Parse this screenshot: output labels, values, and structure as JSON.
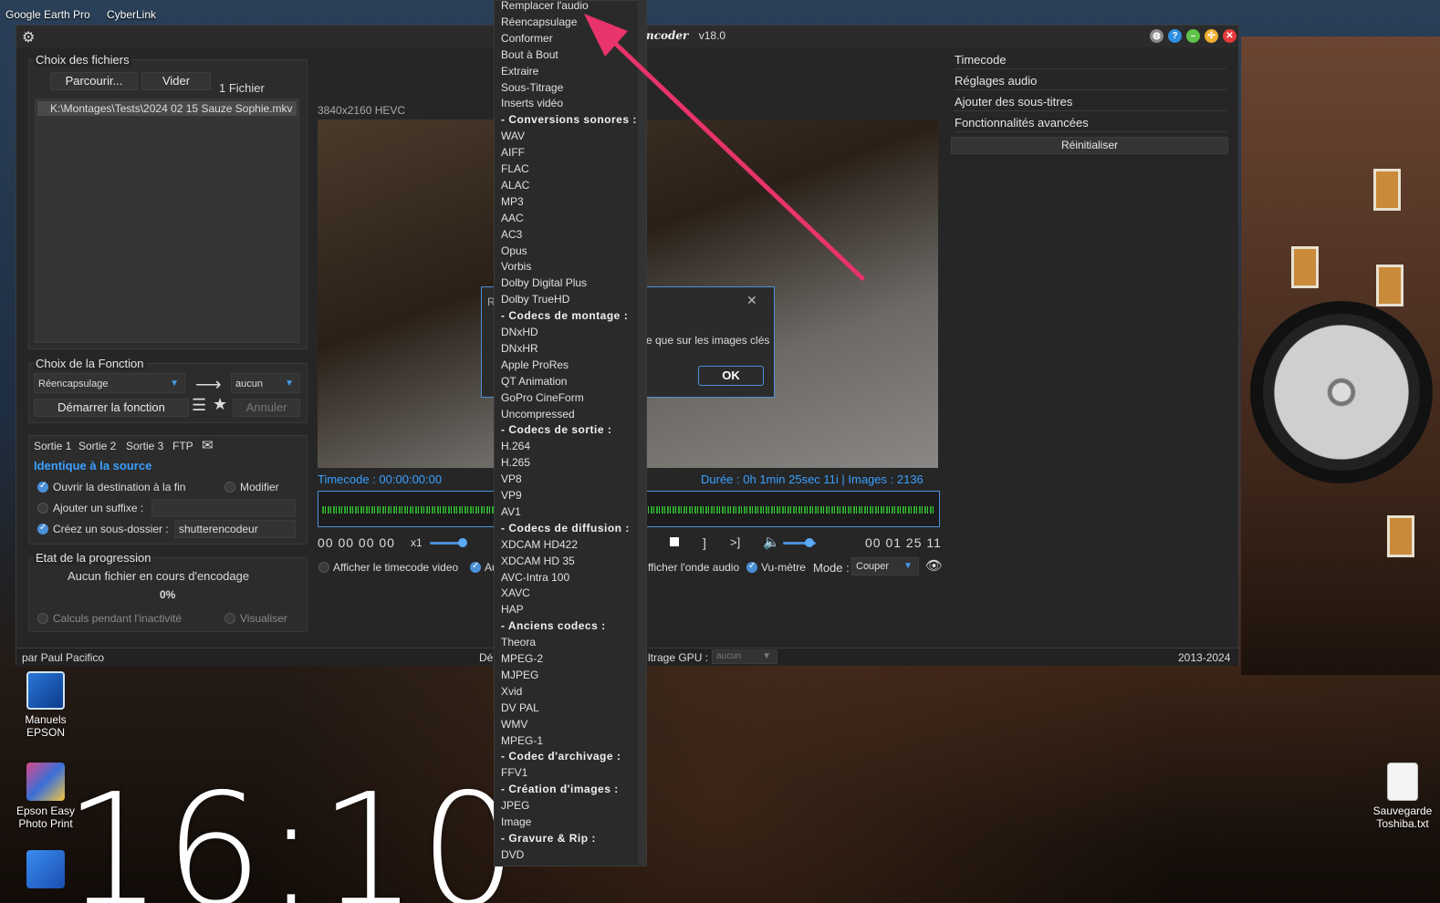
{
  "desktop": {
    "top_icons": [
      "Google Earth Pro",
      "CyberLink"
    ],
    "icons": [
      "Manuels EPSON",
      "Epson Easy Photo Print",
      "Sauvegarde Toshiba.txt"
    ],
    "clock": "16:10"
  },
  "app": {
    "title_logo": "Shutter Encoder",
    "title_visible": "ncoder",
    "version": "v18.0",
    "files": {
      "title": "Choix des fichiers",
      "browse": "Parcourir...",
      "clear": "Vider",
      "count": "1 Fichier",
      "items": [
        "K:\\Montages\\Tests\\2024 02 15 Sauze Sophie.mkv"
      ]
    },
    "function": {
      "title": "Choix de la Fonction",
      "selected": "Réencapsulage",
      "target": "aucun",
      "start": "Démarrer la fonction",
      "cancel": "Annuler"
    },
    "output": {
      "tabs": [
        "Sortie 1",
        "Sortie 2",
        "Sortie 3",
        "FTP"
      ],
      "destination": "Identique à la source",
      "open_dest": "Ouvrir la destination à la fin",
      "modify": "Modifier",
      "add_suffix": "Ajouter un suffixe :",
      "create_subfolder": "Créez un sous-dossier :",
      "subfolder_value": "shutterencodeur"
    },
    "progress": {
      "title": "Etat de la progression",
      "status": "Aucun fichier en cours d'encodage",
      "percent": "0%",
      "idle_calc": "Calculs pendant l'inactivité",
      "visualize": "Visualiser"
    },
    "player": {
      "format": "3840x2160 HEVC",
      "timecode": "Timecode : 00:00:00:00",
      "duration": "Durée : 0h 1min 25sec 11i | Images : 2136",
      "tc_left": "00 00 00 00",
      "speed": "x1",
      "tc_right": "00 01 25 11",
      "show_tc": "Afficher le timecode video",
      "show_au": "Au",
      "show_wave": "fficher l'onde audio",
      "vu_meter": "Vu-mètre",
      "mode_label": "Mode :",
      "mode_value": "Couper",
      "playback_volume": 0.8
    },
    "right_panel": [
      "Timecode",
      "Réglages audio",
      "Ajouter des sous-titres",
      "Fonctionnalités avancées"
    ],
    "reset": "Réinitialiser",
    "status": {
      "author": "par Paul Pacifico",
      "middle": "Dé",
      "gpu_label": "ltrage GPU :",
      "gpu_value": "aucun",
      "years": "2013-2024"
    }
  },
  "dialog": {
    "title_initial": "R",
    "text": "e que sur les images clés",
    "ok": "OK"
  },
  "menu": {
    "items": [
      {
        "t": "Remplacer l'audio",
        "h": false
      },
      {
        "t": "Réencapsulage",
        "h": false
      },
      {
        "t": "Conformer",
        "h": false
      },
      {
        "t": "Bout à Bout",
        "h": false
      },
      {
        "t": "Extraire",
        "h": false
      },
      {
        "t": "Sous-Titrage",
        "h": false
      },
      {
        "t": "Inserts vidéo",
        "h": false
      },
      {
        "t": "- Conversions sonores :",
        "h": true
      },
      {
        "t": "WAV",
        "h": false
      },
      {
        "t": "AIFF",
        "h": false
      },
      {
        "t": "FLAC",
        "h": false
      },
      {
        "t": "ALAC",
        "h": false
      },
      {
        "t": "MP3",
        "h": false
      },
      {
        "t": "AAC",
        "h": false
      },
      {
        "t": "AC3",
        "h": false
      },
      {
        "t": "Opus",
        "h": false
      },
      {
        "t": "Vorbis",
        "h": false
      },
      {
        "t": "Dolby Digital Plus",
        "h": false
      },
      {
        "t": "Dolby TrueHD",
        "h": false
      },
      {
        "t": "- Codecs de montage :",
        "h": true
      },
      {
        "t": "DNxHD",
        "h": false
      },
      {
        "t": "DNxHR",
        "h": false
      },
      {
        "t": "Apple ProRes",
        "h": false
      },
      {
        "t": "QT Animation",
        "h": false
      },
      {
        "t": "GoPro CineForm",
        "h": false
      },
      {
        "t": "Uncompressed",
        "h": false
      },
      {
        "t": "- Codecs de sortie :",
        "h": true
      },
      {
        "t": "H.264",
        "h": false
      },
      {
        "t": "H.265",
        "h": false
      },
      {
        "t": "VP8",
        "h": false
      },
      {
        "t": "VP9",
        "h": false
      },
      {
        "t": "AV1",
        "h": false
      },
      {
        "t": "- Codecs de diffusion :",
        "h": true
      },
      {
        "t": "XDCAM HD422",
        "h": false
      },
      {
        "t": "XDCAM HD 35",
        "h": false
      },
      {
        "t": "AVC-Intra 100",
        "h": false
      },
      {
        "t": "XAVC",
        "h": false
      },
      {
        "t": "HAP",
        "h": false
      },
      {
        "t": "- Anciens codecs :",
        "h": true
      },
      {
        "t": "Theora",
        "h": false
      },
      {
        "t": "MPEG-2",
        "h": false
      },
      {
        "t": "MJPEG",
        "h": false
      },
      {
        "t": "Xvid",
        "h": false
      },
      {
        "t": "DV PAL",
        "h": false
      },
      {
        "t": "WMV",
        "h": false
      },
      {
        "t": "MPEG-1",
        "h": false
      },
      {
        "t": "- Codec d'archivage :",
        "h": true
      },
      {
        "t": "FFV1",
        "h": false
      },
      {
        "t": "- Création d'images :",
        "h": true
      },
      {
        "t": "JPEG",
        "h": false
      },
      {
        "t": "Image",
        "h": false
      },
      {
        "t": "- Gravure & Rip :",
        "h": true
      },
      {
        "t": "DVD",
        "h": false
      }
    ]
  },
  "colors": {
    "accent": "#3ba0ff",
    "arrow": "#e8336b",
    "wave": "#2aa82a"
  }
}
